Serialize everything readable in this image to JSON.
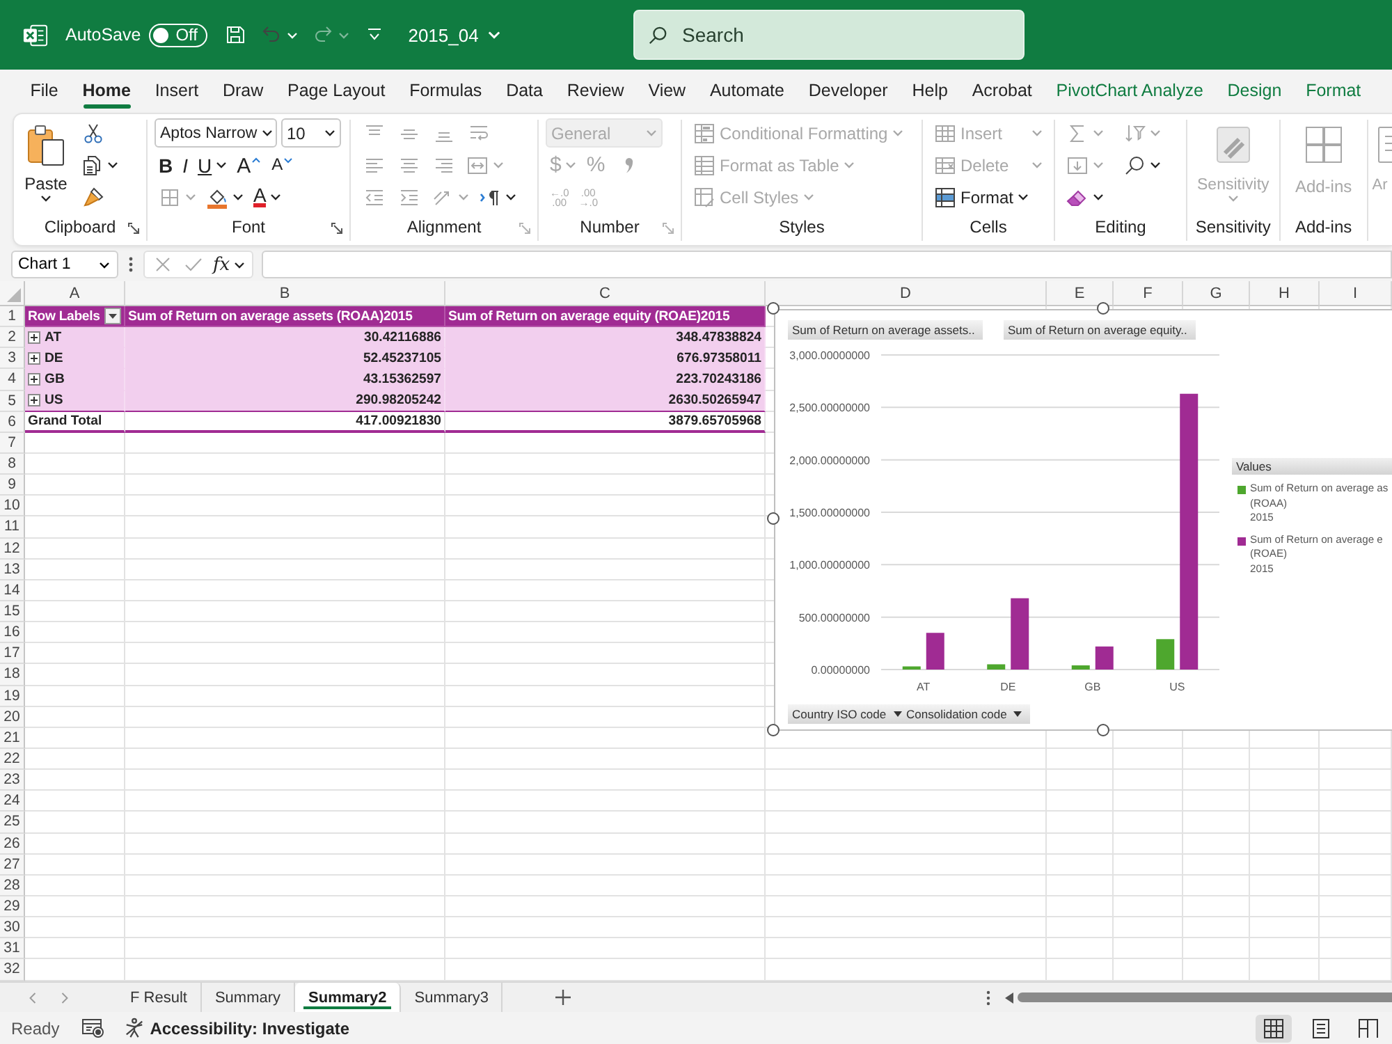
{
  "title_bar": {
    "autosave_label": "AutoSave",
    "autosave": {
      "on": false,
      "label": "Off"
    },
    "quick_access": [
      {
        "kind": "save"
      },
      {
        "kind": "undo",
        "caret": true
      },
      {
        "kind": "redo",
        "caret": true,
        "disabled": true
      },
      {
        "kind": "customize"
      }
    ],
    "file_name": "2015_04",
    "search": {
      "placeholder": "Search"
    }
  },
  "menu_tabs": [
    {
      "label": "File",
      "kind": "main",
      "selected": false
    },
    {
      "label": "Home",
      "kind": "main",
      "selected": true
    },
    {
      "label": "Insert",
      "kind": "main",
      "selected": false
    },
    {
      "label": "Draw",
      "kind": "main",
      "selected": false
    },
    {
      "label": "Page Layout",
      "kind": "main",
      "selected": false
    },
    {
      "label": "Formulas",
      "kind": "main",
      "selected": false
    },
    {
      "label": "Data",
      "kind": "main",
      "selected": false
    },
    {
      "label": "Review",
      "kind": "main",
      "selected": false
    },
    {
      "label": "View",
      "kind": "main",
      "selected": false
    },
    {
      "label": "Automate",
      "kind": "main",
      "selected": false
    },
    {
      "label": "Developer",
      "kind": "main",
      "selected": false
    },
    {
      "label": "Help",
      "kind": "main",
      "selected": false
    },
    {
      "label": "Acrobat",
      "kind": "main",
      "selected": false
    },
    {
      "label": "PivotChart Analyze",
      "kind": "contextual",
      "selected": false
    },
    {
      "label": "Design",
      "kind": "contextual",
      "selected": false
    },
    {
      "label": "Format",
      "kind": "contextual",
      "selected": false
    }
  ],
  "ribbon": {
    "groups": [
      {
        "kind": "clipboard",
        "label": "Clipboard",
        "launcher": {
          "disabled": false
        },
        "items": [
          {
            "kind": "paste",
            "text": "Paste",
            "caret": true
          }
        ],
        "lines": [
          {
            "controls": [
              {
                "kind": "cut"
              }
            ]
          },
          {
            "controls": [
              {
                "kind": "copy",
                "caret": true
              }
            ]
          },
          {
            "controls": [
              {
                "kind": "format_painter"
              }
            ]
          }
        ]
      },
      {
        "kind": "font",
        "label": "Font",
        "launcher": {
          "disabled": false
        },
        "lines": [
          {
            "controls": [
              {
                "kind": "font_name",
                "text": "Aptos Narrow",
                "caret": true
              },
              {
                "kind": "font_size",
                "text": "10",
                "caret": true
              }
            ]
          },
          {
            "controls": [
              {
                "kind": "bold",
                "text": "B"
              },
              {
                "kind": "italic",
                "text": "I"
              },
              {
                "kind": "underline",
                "text": "U",
                "caret": true
              },
              {
                "kind": "grow",
                "text": "A"
              },
              {
                "kind": "shrink",
                "text": "A"
              }
            ]
          },
          {
            "controls": [
              {
                "kind": "borders",
                "caret": true,
                "disabled": true
              },
              {
                "kind": "fill_color",
                "caret": true
              },
              {
                "kind": "font_color",
                "text": "A",
                "caret": true
              }
            ]
          }
        ]
      },
      {
        "kind": "alignment",
        "label": "Alignment",
        "launcher": {
          "disabled": true
        },
        "lines": [
          {
            "controls": [
              {
                "kind": "align_top",
                "disabled": true
              },
              {
                "kind": "align_middle",
                "disabled": true
              },
              {
                "kind": "align_bottom",
                "disabled": true
              },
              {
                "kind": "wrap_text",
                "disabled": true
              }
            ]
          },
          {
            "controls": [
              {
                "kind": "align_left",
                "disabled": true
              },
              {
                "kind": "align_center",
                "disabled": true
              },
              {
                "kind": "align_right",
                "disabled": true
              },
              {
                "kind": "merge",
                "caret": true,
                "disabled": true
              }
            ]
          },
          {
            "controls": [
              {
                "kind": "decrease_indent",
                "disabled": true
              },
              {
                "kind": "increase_indent",
                "disabled": true
              },
              {
                "kind": "orientation",
                "caret": true,
                "disabled": true
              },
              {
                "kind": "text_direction",
                "caret": true
              }
            ]
          }
        ]
      },
      {
        "kind": "number",
        "label": "Number",
        "launcher": {
          "disabled": true
        },
        "lines": [
          {
            "controls": [
              {
                "kind": "number_format",
                "text": "General",
                "caret": true,
                "disabled": true
              }
            ]
          },
          {
            "controls": [
              {
                "kind": "currency",
                "text": "$",
                "caret": true,
                "disabled": true
              },
              {
                "kind": "percent",
                "text": "%",
                "disabled": true
              },
              {
                "kind": "comma",
                "disabled": true
              }
            ]
          },
          {
            "controls": [
              {
                "kind": "increase_decimal",
                "text": "←.0\n.00",
                "disabled": true
              },
              {
                "kind": "decrease_decimal",
                "text": ".00\n→.0",
                "disabled": true
              }
            ]
          }
        ]
      },
      {
        "kind": "styles",
        "label": "Styles",
        "lines": [
          {
            "controls": [
              {
                "kind": "conditional_formatting",
                "text": "Conditional Formatting",
                "caret": true,
                "disabled": true
              }
            ]
          },
          {
            "controls": [
              {
                "kind": "format_as_table",
                "text": "Format as Table",
                "caret": true,
                "disabled": true
              }
            ]
          },
          {
            "controls": [
              {
                "kind": "cell_styles",
                "text": "Cell Styles",
                "caret": true,
                "disabled": true
              }
            ]
          }
        ]
      },
      {
        "kind": "cells",
        "label": "Cells",
        "lines": [
          {
            "controls": [
              {
                "kind": "insert",
                "text": "Insert",
                "caret": true,
                "disabled": true
              }
            ]
          },
          {
            "controls": [
              {
                "kind": "delete",
                "text": "Delete",
                "caret": true,
                "disabled": true
              }
            ]
          },
          {
            "controls": [
              {
                "kind": "format",
                "text": "Format",
                "caret": true
              }
            ]
          }
        ]
      },
      {
        "kind": "editing",
        "label": "Editing",
        "lines": [
          {
            "controls": [
              {
                "kind": "autosum",
                "caret": true,
                "disabled": true
              },
              {
                "kind": "sort_filter",
                "caret": true,
                "disabled": true
              }
            ]
          },
          {
            "controls": [
              {
                "kind": "fill",
                "caret": true,
                "disabled": true
              },
              {
                "kind": "find",
                "caret": true
              }
            ]
          },
          {
            "controls": [
              {
                "kind": "clear",
                "caret": true
              }
            ]
          }
        ]
      },
      {
        "kind": "big",
        "label": "Sensitivity",
        "items": [
          {
            "kind": "sensitivity",
            "text": "Sensitivity",
            "caret": true,
            "disabled": true
          }
        ]
      },
      {
        "kind": "big",
        "label": "Add-ins",
        "items": [
          {
            "kind": "addins",
            "text": "Add-ins",
            "disabled": true
          }
        ]
      },
      {
        "kind": "partial",
        "items": [
          {
            "kind": "analyze",
            "text": "Ar",
            "disabled": true
          }
        ]
      }
    ]
  },
  "formula_bar": {
    "name_box": "Chart 1",
    "buttons": [
      {
        "kind": "cancel",
        "disabled": true
      },
      {
        "kind": "enter",
        "disabled": true
      },
      {
        "kind": "function",
        "text": "fx",
        "caret": true
      }
    ]
  },
  "sheet": {
    "columns": [
      "A",
      "B",
      "C",
      "D",
      "E",
      "F",
      "G",
      "H",
      "I"
    ],
    "rows": [
      "1",
      "2",
      "3",
      "4",
      "5",
      "6",
      "7",
      "8",
      "9",
      "10",
      "11",
      "12",
      "13",
      "14",
      "15",
      "16",
      "17",
      "18",
      "19",
      "20",
      "21",
      "22",
      "23",
      "24",
      "25",
      "26",
      "27",
      "28",
      "29",
      "30",
      "31",
      "32"
    ],
    "pivot": {
      "header": {
        "row_label": "Row Labels",
        "columns": [
          "Sum of Return on average assets (ROAA)2015",
          "Sum of Return on average equity (ROAE)2015"
        ]
      },
      "rows": [
        {
          "kind": "item",
          "label": "AT",
          "expanded": false,
          "values": [
            "30.42116886",
            "348.47838824"
          ]
        },
        {
          "kind": "item",
          "label": "DE",
          "expanded": false,
          "values": [
            "52.45237105",
            "676.97358011"
          ]
        },
        {
          "kind": "item",
          "label": "GB",
          "expanded": false,
          "values": [
            "43.15362597",
            "223.70243186"
          ]
        },
        {
          "kind": "item",
          "label": "US",
          "expanded": false,
          "values": [
            "290.98205242",
            "2630.50265947"
          ]
        },
        {
          "kind": "total",
          "label": "Grand Total",
          "values": [
            "417.00921830",
            "3879.65705968"
          ]
        }
      ]
    },
    "chart": {
      "selected": true,
      "value_fields": [
        {
          "label": "Sum of Return on average assets..",
          "dropdown": false
        },
        {
          "label": "Sum of Return on average equity..",
          "dropdown": false
        }
      ],
      "axis_fields": [
        {
          "label": "Country ISO code",
          "dropdown": true
        },
        {
          "label": "Consolidation code",
          "dropdown": true
        }
      ],
      "legend_title": "Values",
      "chart_data": {
        "type": "bar",
        "categories": [
          "AT",
          "DE",
          "GB",
          "US"
        ],
        "series": [
          {
            "name": "Sum of Return on average as\n(ROAA)\n2015",
            "color": "#4ea72e",
            "values": [
              30,
              50,
              40,
              290
            ]
          },
          {
            "name": "Sum of Return on average e\n(ROAE)\n2015",
            "color": "#a02b93",
            "values": [
              350,
              680,
              220,
              2630
            ]
          }
        ],
        "ylim": [
          0,
          3000
        ],
        "yticks": [
          {
            "value": 0,
            "label": "0.00000000"
          },
          {
            "value": 500,
            "label": "500.00000000"
          },
          {
            "value": 1000,
            "label": "1,000.00000000"
          },
          {
            "value": 1500,
            "label": "1,500.00000000"
          },
          {
            "value": 2000,
            "label": "2,000.00000000"
          },
          {
            "value": 2500,
            "label": "2,500.00000000"
          },
          {
            "value": 3000,
            "label": "3,000.00000000"
          }
        ],
        "grid": true,
        "legend": "right"
      }
    }
  },
  "sheet_tabs": [
    {
      "label": "F Result",
      "selected": false
    },
    {
      "label": "Summary",
      "selected": false
    },
    {
      "label": "Summary2",
      "selected": true
    },
    {
      "label": "Summary3",
      "selected": false
    }
  ],
  "status_bar": {
    "ready": "Ready",
    "accessibility": "Accessibility: Investigate",
    "views": [
      {
        "kind": "normal",
        "selected": true
      },
      {
        "kind": "page_layout",
        "selected": false
      },
      {
        "kind": "page_break",
        "selected": false
      }
    ]
  }
}
